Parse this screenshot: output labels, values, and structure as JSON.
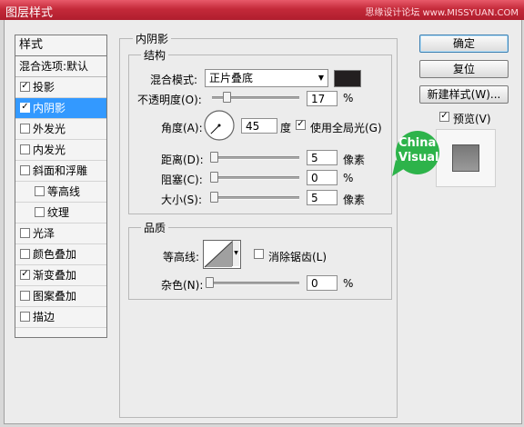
{
  "window": {
    "title": "图层样式",
    "watermark": "思缘设计论坛 www.MISSYUAN.COM"
  },
  "styles_panel": {
    "header": "样式",
    "blend_options": "混合选项:默认",
    "items": [
      {
        "label": "投影",
        "checked": true,
        "selected": false,
        "sub": false
      },
      {
        "label": "内阴影",
        "checked": true,
        "selected": true,
        "sub": false
      },
      {
        "label": "外发光",
        "checked": false,
        "selected": false,
        "sub": false
      },
      {
        "label": "内发光",
        "checked": false,
        "selected": false,
        "sub": false
      },
      {
        "label": "斜面和浮雕",
        "checked": false,
        "selected": false,
        "sub": false
      },
      {
        "label": "等高线",
        "checked": false,
        "selected": false,
        "sub": true
      },
      {
        "label": "纹理",
        "checked": false,
        "selected": false,
        "sub": true
      },
      {
        "label": "光泽",
        "checked": false,
        "selected": false,
        "sub": false
      },
      {
        "label": "颜色叠加",
        "checked": false,
        "selected": false,
        "sub": false
      },
      {
        "label": "渐变叠加",
        "checked": true,
        "selected": false,
        "sub": false
      },
      {
        "label": "图案叠加",
        "checked": false,
        "selected": false,
        "sub": false
      },
      {
        "label": "描边",
        "checked": false,
        "selected": false,
        "sub": false
      }
    ]
  },
  "inner_shadow": {
    "title": "内阴影",
    "structure": {
      "title": "结构",
      "blend_mode_label": "混合模式:",
      "blend_mode_value": "正片叠底",
      "shadow_color": "#231f20",
      "opacity_label": "不透明度(O):",
      "opacity_value": "17",
      "opacity_unit": "%",
      "opacity_level": 0.17,
      "angle_label": "角度(A):",
      "angle_value": "45",
      "angle_unit": "度",
      "use_global_light_label": "使用全局光(G)",
      "use_global_light": true,
      "distance_label": "距离(D):",
      "distance_value": "5",
      "distance_unit": "像素",
      "choke_label": "阻塞(C):",
      "choke_value": "0",
      "choke_unit": "%",
      "size_label": "大小(S):",
      "size_value": "5",
      "size_unit": "像素"
    },
    "quality": {
      "title": "品质",
      "contour_label": "等高线:",
      "anti_alias_label": "消除锯齿(L)",
      "anti_alias": false,
      "noise_label": "杂色(N):",
      "noise_value": "0",
      "noise_unit": "%"
    }
  },
  "buttons": {
    "ok": "确定",
    "reset": "复位",
    "new_style": "新建样式(W)...",
    "preview_label": "预览(V)",
    "preview_checked": true
  },
  "logo": {
    "line1": "China",
    "line2": "Visual",
    "color": "#2db34a"
  }
}
